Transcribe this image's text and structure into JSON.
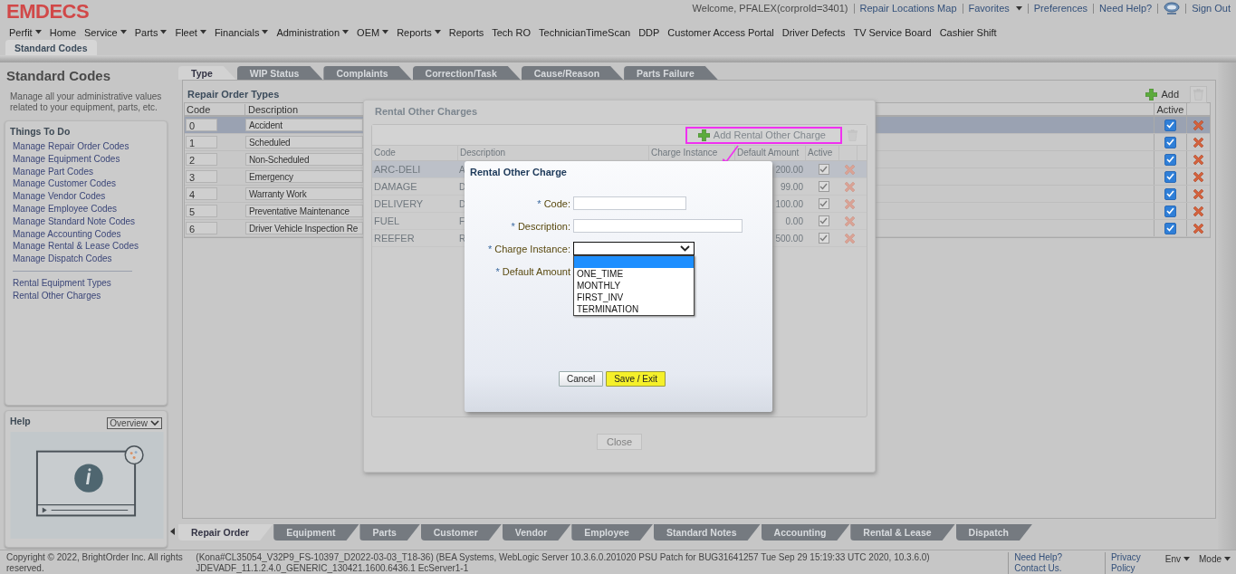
{
  "header": {
    "logo": "EMDECS",
    "welcome": "Welcome, PFALEX(corproId=3401)",
    "links": [
      {
        "label": "Repair Locations Map",
        "dropdown": false
      },
      {
        "label": "Favorites",
        "dropdown": true
      },
      {
        "label": "Preferences",
        "dropdown": false
      },
      {
        "label": "Need Help?",
        "dropdown": false
      }
    ],
    "sign_out": "Sign Out"
  },
  "menu": [
    {
      "label": "Perfit",
      "dropdown": true
    },
    {
      "label": "Home",
      "dropdown": false
    },
    {
      "label": "Service",
      "dropdown": true
    },
    {
      "label": "Parts",
      "dropdown": true
    },
    {
      "label": "Fleet",
      "dropdown": true
    },
    {
      "label": "Financials",
      "dropdown": true
    },
    {
      "label": "Administration",
      "dropdown": true
    },
    {
      "label": "OEM",
      "dropdown": true
    },
    {
      "label": "Reports",
      "dropdown": true
    },
    {
      "label": "Reports",
      "dropdown": false
    },
    {
      "label": "Tech RO",
      "dropdown": false
    },
    {
      "label": "TechnicianTimeScan",
      "dropdown": false
    },
    {
      "label": "DDP",
      "dropdown": false
    },
    {
      "label": "Customer Access Portal",
      "dropdown": false
    },
    {
      "label": "Driver Defects",
      "dropdown": false
    },
    {
      "label": "TV Service Board",
      "dropdown": false
    },
    {
      "label": "Cashier Shift",
      "dropdown": false
    }
  ],
  "page_tab": "Standard Codes",
  "sidebar": {
    "title": "Standard Codes",
    "description": "Manage all your administrative values related to your equipment, parts, etc.",
    "things_to_do": {
      "title": "Things To Do",
      "links": [
        "Manage Repair Order Codes",
        "Manage Equipment Codes",
        "Manage Part Codes",
        "Manage Customer Codes",
        "Manage Vendor Codes",
        "Manage Employee Codes",
        "Manage Standard Note Codes",
        "Manage Accounting Codes",
        "Manage Rental & Lease Codes",
        "Manage Dispatch Codes"
      ],
      "extra_links": [
        "Rental Equipment Types",
        "Rental Other Charges"
      ]
    },
    "help": {
      "title": "Help",
      "select": "Overview"
    }
  },
  "tabs": [
    {
      "label": "Type",
      "selected": true
    },
    {
      "label": "WIP Status",
      "selected": false
    },
    {
      "label": "Complaints",
      "selected": false
    },
    {
      "label": "Correction/Task",
      "selected": false
    },
    {
      "label": "Cause/Reason",
      "selected": false
    },
    {
      "label": "Parts Failure",
      "selected": false
    }
  ],
  "repair_order_types": {
    "title": "Repair Order Types",
    "add": "Add",
    "columns": [
      "Code",
      "Description",
      "Active"
    ],
    "rows": [
      {
        "code": "0",
        "description": "Accident",
        "active": true,
        "selected": true
      },
      {
        "code": "1",
        "description": "Scheduled",
        "active": true,
        "selected": false
      },
      {
        "code": "2",
        "description": "Non-Scheduled",
        "active": true,
        "selected": false
      },
      {
        "code": "3",
        "description": "Emergency",
        "active": true,
        "selected": false
      },
      {
        "code": "4",
        "description": "Warranty Work",
        "active": true,
        "selected": false
      },
      {
        "code": "5",
        "description": "Preventative Maintenance",
        "active": true,
        "selected": false
      },
      {
        "code": "6",
        "description": "Driver Vehicle Inspection Re",
        "active": true,
        "selected": false
      }
    ]
  },
  "bottom_tabs": [
    {
      "label": "Repair Order",
      "selected": true
    },
    {
      "label": "Equipment",
      "selected": false
    },
    {
      "label": "Parts",
      "selected": false
    },
    {
      "label": "Customer",
      "selected": false
    },
    {
      "label": "Vendor",
      "selected": false
    },
    {
      "label": "Employee",
      "selected": false
    },
    {
      "label": "Standard Notes",
      "selected": false
    },
    {
      "label": "Accounting",
      "selected": false
    },
    {
      "label": "Rental & Lease",
      "selected": false
    },
    {
      "label": "Dispatch",
      "selected": false
    }
  ],
  "rental_window": {
    "title": "Rental Other Charges",
    "add": "Add Rental Other Charge",
    "highlighted": true,
    "columns": [
      "Code",
      "Description",
      "Charge Instance",
      "Default Amount",
      "Active"
    ],
    "rows": [
      {
        "code": "ARC-DELI",
        "description": "A",
        "amount": "200.00",
        "active": true,
        "selected": true
      },
      {
        "code": "DAMAGE",
        "description": "D",
        "amount": "99.00",
        "active": true,
        "selected": false
      },
      {
        "code": "DELIVERY",
        "description": "D",
        "amount": "100.00",
        "active": true,
        "selected": false
      },
      {
        "code": "FUEL",
        "description": "F",
        "amount": "0.00",
        "active": true,
        "selected": false
      },
      {
        "code": "REEFER",
        "description": "R",
        "amount": "500.00",
        "active": true,
        "selected": false
      }
    ],
    "close": "Close"
  },
  "dialog": {
    "title": "Rental Other Charge",
    "fields": [
      {
        "marker": "*",
        "label": "Code:",
        "kind": "text"
      },
      {
        "marker": "*",
        "label": "Description:",
        "kind": "text"
      },
      {
        "marker": "*",
        "label": "Charge Instance:",
        "kind": "select",
        "expanded": true,
        "options": [
          {
            "selected": true
          },
          {
            "label": "ONE_TIME",
            "selected": false
          },
          {
            "label": "MONTHLY",
            "selected": false
          },
          {
            "label": "FIRST_INV",
            "selected": false
          },
          {
            "label": "TERMINATION",
            "selected": false
          }
        ]
      },
      {
        "marker": "*",
        "label": "Default Amount",
        "kind": "label"
      }
    ],
    "buttons": [
      {
        "label": "Cancel",
        "kind": "default"
      },
      {
        "label": "Save / Exit",
        "kind": "primary"
      }
    ]
  },
  "footer": {
    "copyright": "Copyright © 2022, BrightOrder Inc. All rights reserved.",
    "build": [
      "(Kona#CL35054_V32P9_FS-10397_D2022-03-03_T18-36) (BEA Systems, WebLogic Server 10.3.6.0.201020 PSU Patch for BUG31641257 Tue Sep 29 15:19:33 UTC 2020, 10.3.6.0)",
      "JDEVADF_11.1.2.4.0_GENERIC_130421.1600.6436.1 EcServer1-1"
    ],
    "links": [
      "Need Help? Contact Us.",
      "Privacy Policy"
    ],
    "menus": [
      "Env",
      "Mode"
    ]
  }
}
